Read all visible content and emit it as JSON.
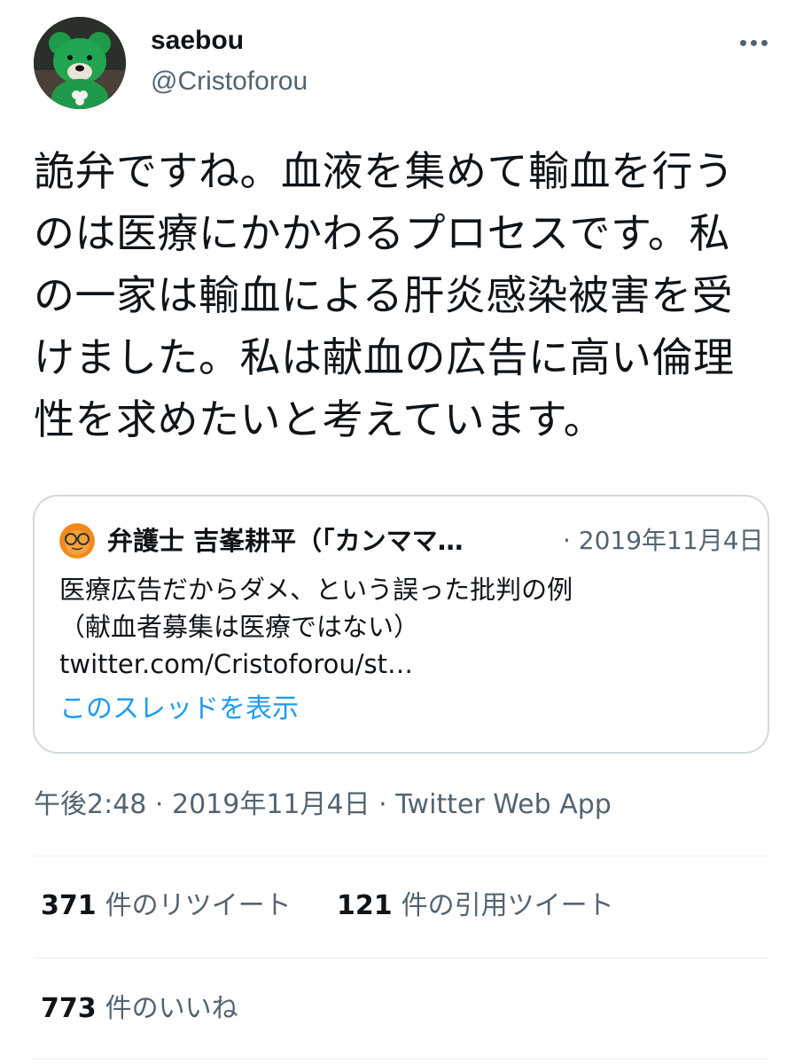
{
  "author": {
    "display_name": "saebou",
    "handle": "@Cristoforou",
    "avatar_icon": "green-bear-avatar"
  },
  "more_icon": "more-horizontal-icon",
  "tweet": {
    "text": "詭弁ですね。血液を集めて輸血を行うのは医療にかかわるプロセスです。私の一家は輸血による肝炎感染被害を受けました。私は献血の広告に高い倫理性を求めたいと考えています。"
  },
  "quote": {
    "avatar_icon": "glasses-face-avatar",
    "name": "弁護士 吉峯耕平（「カンママ…",
    "date": "· 2019年11月4日",
    "body_line1": "医療広告だからダメ、という誤った批判の例",
    "body_line2": "（献血者募集は医療ではない）",
    "link": "twitter.com/Cristoforou/st…",
    "thread_label": "このスレッドを表示"
  },
  "meta": "午後2:48 · 2019年11月4日 · Twitter Web App",
  "stats": {
    "retweets_count": "371",
    "retweets_label": "件のリツイート",
    "quotes_count": "121",
    "quotes_label": "件の引用ツイート",
    "likes_count": "773",
    "likes_label": "件のいいね"
  },
  "colors": {
    "link": "#1d9bf0",
    "secondary_text": "#536471",
    "border": "#cfd9de"
  }
}
